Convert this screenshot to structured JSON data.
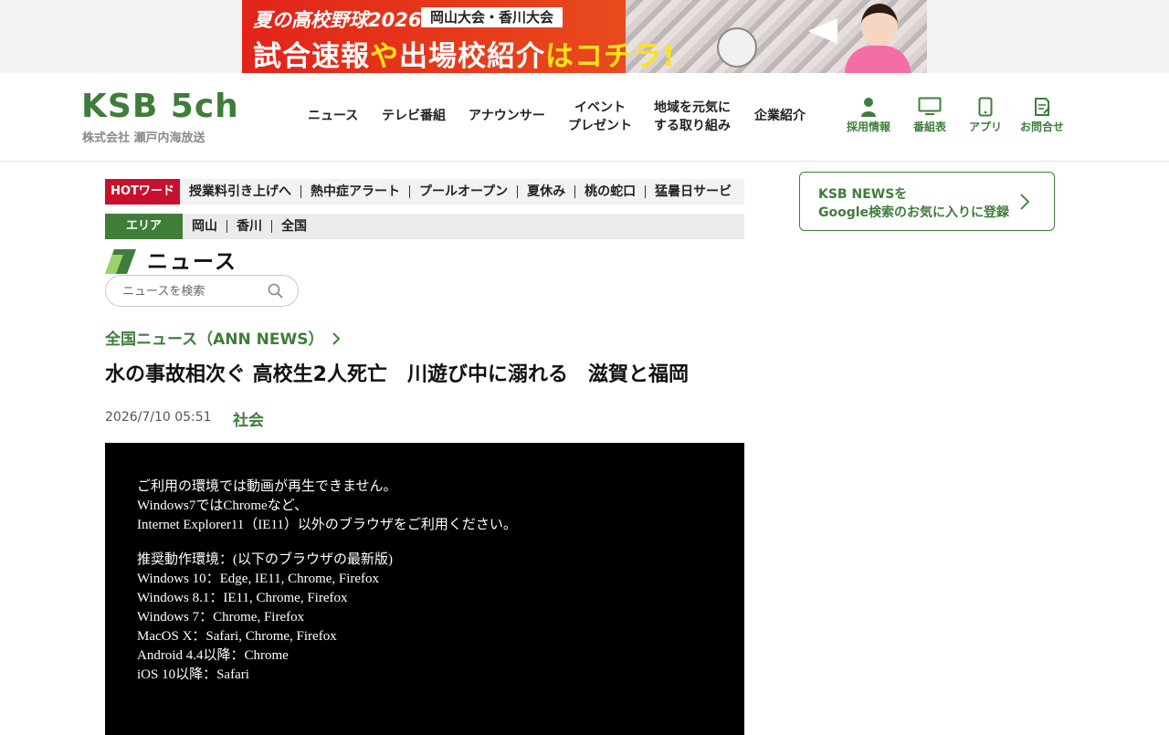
{
  "banner": {
    "line1": "夏の高校野球2026",
    "tag": "岡山大会・香川大会",
    "line2_a": "試合速報",
    "line2_b": "や",
    "line2_c": "出場校紹介",
    "line2_d": "はコチラ!"
  },
  "header": {
    "logo": "KSB 5ch",
    "logo_sub": "株式会社 瀬戸内海放送",
    "nav": [
      {
        "line1": "ニュース",
        "line2": ""
      },
      {
        "line1": "テレビ番組",
        "line2": ""
      },
      {
        "line1": "アナウンサー",
        "line2": ""
      },
      {
        "line1": "イベント",
        "line2": "プレゼント"
      },
      {
        "line1": "地域を元気に",
        "line2": "する取り組み"
      },
      {
        "line1": "企業紹介",
        "line2": ""
      }
    ],
    "utility": [
      {
        "label": "採用情報",
        "icon": "person-icon"
      },
      {
        "label": "番組表",
        "icon": "tv-icon"
      },
      {
        "label": "アプリ",
        "icon": "smartphone-icon"
      },
      {
        "label": "お問合せ",
        "icon": "contact-form-icon"
      }
    ]
  },
  "hotwords": {
    "label": "HOTワード",
    "items": [
      "授業料引き上げへ",
      "熱中症アラート",
      "プールオープン",
      "夏休み",
      "桃の蛇口",
      "猛暑日サービ"
    ]
  },
  "areas": {
    "label": "エリア",
    "items": [
      "岡山",
      "香川",
      "全国"
    ]
  },
  "section": {
    "title": "ニュース"
  },
  "search": {
    "placeholder": "ニュースを検索"
  },
  "article": {
    "breadcrumb": "全国ニュース（ANN NEWS）",
    "headline": "水の事故相次ぐ 高校生2人死亡　川遊び中に溺れる　滋賀と福岡",
    "date": "2026/7/10 05:51",
    "category": "社会"
  },
  "video": {
    "lines_a": [
      "ご利用の環境では動画が再生できません。",
      "Windows7ではChromeなど、",
      "Internet Explorer11（IE11）以外のブラウザをご利用ください。"
    ],
    "lines_b": [
      "推奨動作環境：(以下のブラウザの最新版)",
      "Windows 10：Edge, IE11, Chrome, Firefox",
      "Windows 8.1：IE11, Chrome, Firefox",
      "Windows 7：Chrome, Firefox",
      "MacOS X：Safari, Chrome, Firefox",
      "Android 4.4以降：Chrome",
      "iOS 10以降：Safari"
    ]
  },
  "sidebar": {
    "google_line1": "KSB NEWSを",
    "google_line2": "Google検索のお気に入りに登録"
  },
  "colors": {
    "brand_green": "#3f7d3a",
    "hot_red": "#c8102e",
    "banner_red": "#e32319"
  }
}
